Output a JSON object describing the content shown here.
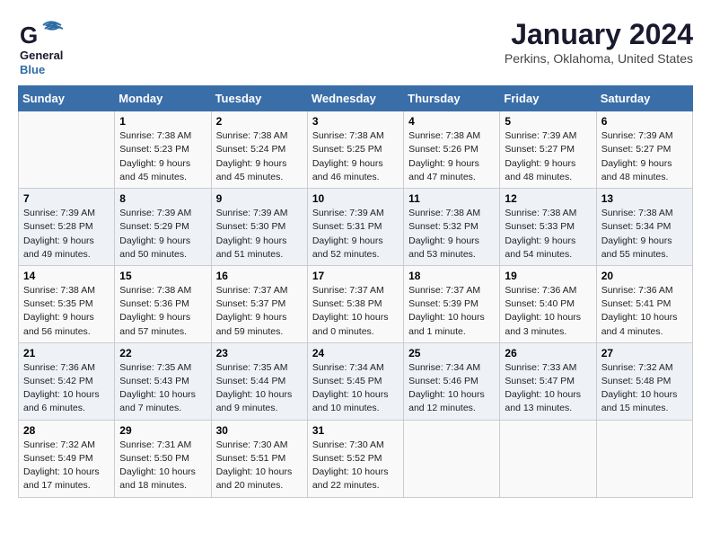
{
  "header": {
    "logo": {
      "general": "General",
      "blue": "Blue"
    },
    "title": "January 2024",
    "subtitle": "Perkins, Oklahoma, United States"
  },
  "calendar": {
    "days_of_week": [
      "Sunday",
      "Monday",
      "Tuesday",
      "Wednesday",
      "Thursday",
      "Friday",
      "Saturday"
    ],
    "weeks": [
      [
        {
          "day": "",
          "sunrise": "",
          "sunset": "",
          "daylight": ""
        },
        {
          "day": "1",
          "sunrise": "Sunrise: 7:38 AM",
          "sunset": "Sunset: 5:23 PM",
          "daylight": "Daylight: 9 hours and 45 minutes."
        },
        {
          "day": "2",
          "sunrise": "Sunrise: 7:38 AM",
          "sunset": "Sunset: 5:24 PM",
          "daylight": "Daylight: 9 hours and 45 minutes."
        },
        {
          "day": "3",
          "sunrise": "Sunrise: 7:38 AM",
          "sunset": "Sunset: 5:25 PM",
          "daylight": "Daylight: 9 hours and 46 minutes."
        },
        {
          "day": "4",
          "sunrise": "Sunrise: 7:38 AM",
          "sunset": "Sunset: 5:26 PM",
          "daylight": "Daylight: 9 hours and 47 minutes."
        },
        {
          "day": "5",
          "sunrise": "Sunrise: 7:39 AM",
          "sunset": "Sunset: 5:27 PM",
          "daylight": "Daylight: 9 hours and 48 minutes."
        },
        {
          "day": "6",
          "sunrise": "Sunrise: 7:39 AM",
          "sunset": "Sunset: 5:27 PM",
          "daylight": "Daylight: 9 hours and 48 minutes."
        }
      ],
      [
        {
          "day": "7",
          "sunrise": "Sunrise: 7:39 AM",
          "sunset": "Sunset: 5:28 PM",
          "daylight": "Daylight: 9 hours and 49 minutes."
        },
        {
          "day": "8",
          "sunrise": "Sunrise: 7:39 AM",
          "sunset": "Sunset: 5:29 PM",
          "daylight": "Daylight: 9 hours and 50 minutes."
        },
        {
          "day": "9",
          "sunrise": "Sunrise: 7:39 AM",
          "sunset": "Sunset: 5:30 PM",
          "daylight": "Daylight: 9 hours and 51 minutes."
        },
        {
          "day": "10",
          "sunrise": "Sunrise: 7:39 AM",
          "sunset": "Sunset: 5:31 PM",
          "daylight": "Daylight: 9 hours and 52 minutes."
        },
        {
          "day": "11",
          "sunrise": "Sunrise: 7:38 AM",
          "sunset": "Sunset: 5:32 PM",
          "daylight": "Daylight: 9 hours and 53 minutes."
        },
        {
          "day": "12",
          "sunrise": "Sunrise: 7:38 AM",
          "sunset": "Sunset: 5:33 PM",
          "daylight": "Daylight: 9 hours and 54 minutes."
        },
        {
          "day": "13",
          "sunrise": "Sunrise: 7:38 AM",
          "sunset": "Sunset: 5:34 PM",
          "daylight": "Daylight: 9 hours and 55 minutes."
        }
      ],
      [
        {
          "day": "14",
          "sunrise": "Sunrise: 7:38 AM",
          "sunset": "Sunset: 5:35 PM",
          "daylight": "Daylight: 9 hours and 56 minutes."
        },
        {
          "day": "15",
          "sunrise": "Sunrise: 7:38 AM",
          "sunset": "Sunset: 5:36 PM",
          "daylight": "Daylight: 9 hours and 57 minutes."
        },
        {
          "day": "16",
          "sunrise": "Sunrise: 7:37 AM",
          "sunset": "Sunset: 5:37 PM",
          "daylight": "Daylight: 9 hours and 59 minutes."
        },
        {
          "day": "17",
          "sunrise": "Sunrise: 7:37 AM",
          "sunset": "Sunset: 5:38 PM",
          "daylight": "Daylight: 10 hours and 0 minutes."
        },
        {
          "day": "18",
          "sunrise": "Sunrise: 7:37 AM",
          "sunset": "Sunset: 5:39 PM",
          "daylight": "Daylight: 10 hours and 1 minute."
        },
        {
          "day": "19",
          "sunrise": "Sunrise: 7:36 AM",
          "sunset": "Sunset: 5:40 PM",
          "daylight": "Daylight: 10 hours and 3 minutes."
        },
        {
          "day": "20",
          "sunrise": "Sunrise: 7:36 AM",
          "sunset": "Sunset: 5:41 PM",
          "daylight": "Daylight: 10 hours and 4 minutes."
        }
      ],
      [
        {
          "day": "21",
          "sunrise": "Sunrise: 7:36 AM",
          "sunset": "Sunset: 5:42 PM",
          "daylight": "Daylight: 10 hours and 6 minutes."
        },
        {
          "day": "22",
          "sunrise": "Sunrise: 7:35 AM",
          "sunset": "Sunset: 5:43 PM",
          "daylight": "Daylight: 10 hours and 7 minutes."
        },
        {
          "day": "23",
          "sunrise": "Sunrise: 7:35 AM",
          "sunset": "Sunset: 5:44 PM",
          "daylight": "Daylight: 10 hours and 9 minutes."
        },
        {
          "day": "24",
          "sunrise": "Sunrise: 7:34 AM",
          "sunset": "Sunset: 5:45 PM",
          "daylight": "Daylight: 10 hours and 10 minutes."
        },
        {
          "day": "25",
          "sunrise": "Sunrise: 7:34 AM",
          "sunset": "Sunset: 5:46 PM",
          "daylight": "Daylight: 10 hours and 12 minutes."
        },
        {
          "day": "26",
          "sunrise": "Sunrise: 7:33 AM",
          "sunset": "Sunset: 5:47 PM",
          "daylight": "Daylight: 10 hours and 13 minutes."
        },
        {
          "day": "27",
          "sunrise": "Sunrise: 7:32 AM",
          "sunset": "Sunset: 5:48 PM",
          "daylight": "Daylight: 10 hours and 15 minutes."
        }
      ],
      [
        {
          "day": "28",
          "sunrise": "Sunrise: 7:32 AM",
          "sunset": "Sunset: 5:49 PM",
          "daylight": "Daylight: 10 hours and 17 minutes."
        },
        {
          "day": "29",
          "sunrise": "Sunrise: 7:31 AM",
          "sunset": "Sunset: 5:50 PM",
          "daylight": "Daylight: 10 hours and 18 minutes."
        },
        {
          "day": "30",
          "sunrise": "Sunrise: 7:30 AM",
          "sunset": "Sunset: 5:51 PM",
          "daylight": "Daylight: 10 hours and 20 minutes."
        },
        {
          "day": "31",
          "sunrise": "Sunrise: 7:30 AM",
          "sunset": "Sunset: 5:52 PM",
          "daylight": "Daylight: 10 hours and 22 minutes."
        },
        {
          "day": "",
          "sunrise": "",
          "sunset": "",
          "daylight": ""
        },
        {
          "day": "",
          "sunrise": "",
          "sunset": "",
          "daylight": ""
        },
        {
          "day": "",
          "sunrise": "",
          "sunset": "",
          "daylight": ""
        }
      ]
    ]
  }
}
